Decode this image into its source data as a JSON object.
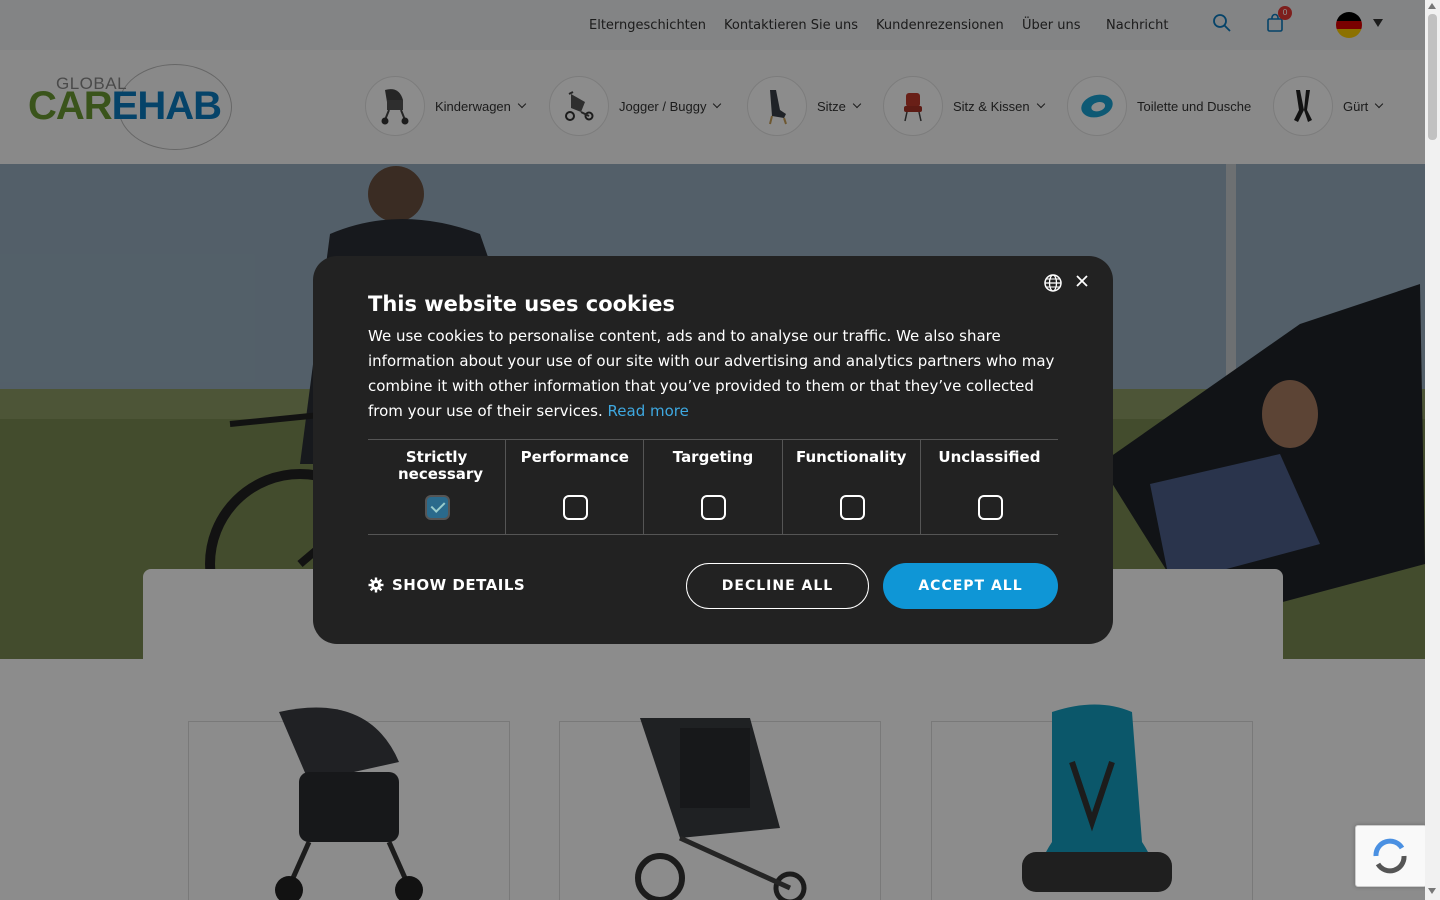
{
  "topbar": {
    "links": [
      "Elterngeschichten",
      "Kontaktieren Sie uns",
      "Kundenrezensionen",
      "Über uns",
      "Nachricht"
    ],
    "cart_count": "0",
    "icons": [
      "search-icon",
      "shopping-bag-icon",
      "flag-de-icon",
      "caret-down-icon"
    ]
  },
  "header": {
    "logo": {
      "small": "GLOBAL",
      "big_green": "CAR",
      "big_blue": "EHAB"
    },
    "categories": [
      {
        "label": "Kinderwagen",
        "icon": "stroller-icon",
        "has_dropdown": true
      },
      {
        "label": "Jogger / Buggy",
        "icon": "jogger-icon",
        "has_dropdown": true
      },
      {
        "label": "Sitze",
        "icon": "seat-icon",
        "has_dropdown": true
      },
      {
        "label": "Sitz & Kissen",
        "icon": "cushion-chair-icon",
        "has_dropdown": true
      },
      {
        "label": "Toilette und Dusche",
        "icon": "toilet-seat-icon",
        "has_dropdown": false
      },
      {
        "label": "Gürt",
        "icon": "harness-icon",
        "has_dropdown": true
      }
    ]
  },
  "cookie_modal": {
    "title": "This website uses cookies",
    "body": "We use cookies to personalise content, ads and to analyse our traffic. We also share information about your use of our site with our advertising and analytics partners who may combine it with other information that you’ve provided to them or that they’ve collected from your use of their services.",
    "read_more": "Read more",
    "categories": [
      {
        "label": "Strictly necessary",
        "checked": true
      },
      {
        "label": "Performance",
        "checked": false
      },
      {
        "label": "Targeting",
        "checked": false
      },
      {
        "label": "Functionality",
        "checked": false
      },
      {
        "label": "Unclassified",
        "checked": false
      }
    ],
    "show_details": "SHOW DETAILS",
    "decline_all": "DECLINE ALL",
    "accept_all": "ACCEPT ALL"
  },
  "products": [
    {
      "image": "stroller-product-image"
    },
    {
      "image": "jogger-product-image"
    },
    {
      "image": "child-seat-product-image"
    }
  ],
  "colors": {
    "accent": "#0f96d6",
    "modal_bg": "#222222",
    "logo_green": "#6a9a32",
    "logo_blue": "#0a7abf"
  }
}
